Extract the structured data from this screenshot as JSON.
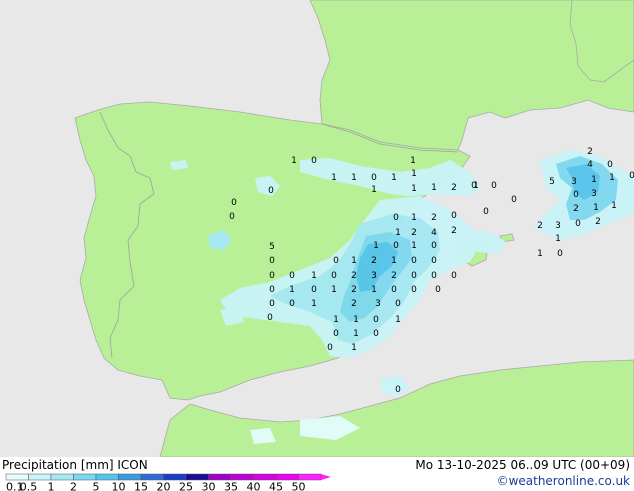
{
  "map": {
    "colors": {
      "sea": "#e8e8e8",
      "land": "#b9f097",
      "border": "#9aa0a0",
      "coast": "#a9a9a9"
    },
    "precip_values": [
      "1",
      "0",
      "1",
      "1",
      "1",
      "0",
      "1",
      "1",
      "0",
      "1",
      "1",
      "1",
      "2",
      "0",
      "0",
      "0",
      "0",
      "0",
      "0",
      "1",
      "2",
      "0",
      "1",
      "2",
      "4",
      "2",
      "1",
      "0",
      "1",
      "0",
      "5",
      "0",
      "0",
      "1",
      "2",
      "1",
      "0",
      "0",
      "0",
      "0",
      "1",
      "0",
      "2",
      "3",
      "2",
      "0",
      "0",
      "0",
      "0",
      "1",
      "0",
      "1",
      "2",
      "1",
      "0",
      "0",
      "0",
      "0",
      "0",
      "1",
      "2",
      "3",
      "0",
      "0",
      "1",
      "1",
      "0",
      "1",
      "0",
      "1",
      "0",
      "0",
      "1",
      "0",
      "2",
      "4",
      "0",
      "0",
      "5",
      "3",
      "1",
      "1",
      "0",
      "3",
      "2",
      "1",
      "1",
      "2",
      "3",
      "0",
      "2",
      "1",
      "1",
      "0",
      "0",
      "1"
    ]
  },
  "footer": {
    "title": "Precipitation [mm]",
    "model": "ICON",
    "datetime": "Mo 13-10-2025 06..09 UTC (00+09)",
    "credit": "©weatheronline.co.uk",
    "legend": {
      "ticks": [
        "0.1",
        "0.5",
        "1",
        "2",
        "5",
        "10",
        "15",
        "20",
        "25",
        "30",
        "35",
        "40",
        "45",
        "50"
      ],
      "colors": [
        "#e4fcfc",
        "#c8f4f8",
        "#a4e8f4",
        "#7cd8f0",
        "#54c4ec",
        "#3c9ce0",
        "#2c6cd4",
        "#1c3cc4",
        "#180c98",
        "#a000c8",
        "#c000d8",
        "#d800e4",
        "#f000f0",
        "#ff20ff"
      ]
    }
  }
}
